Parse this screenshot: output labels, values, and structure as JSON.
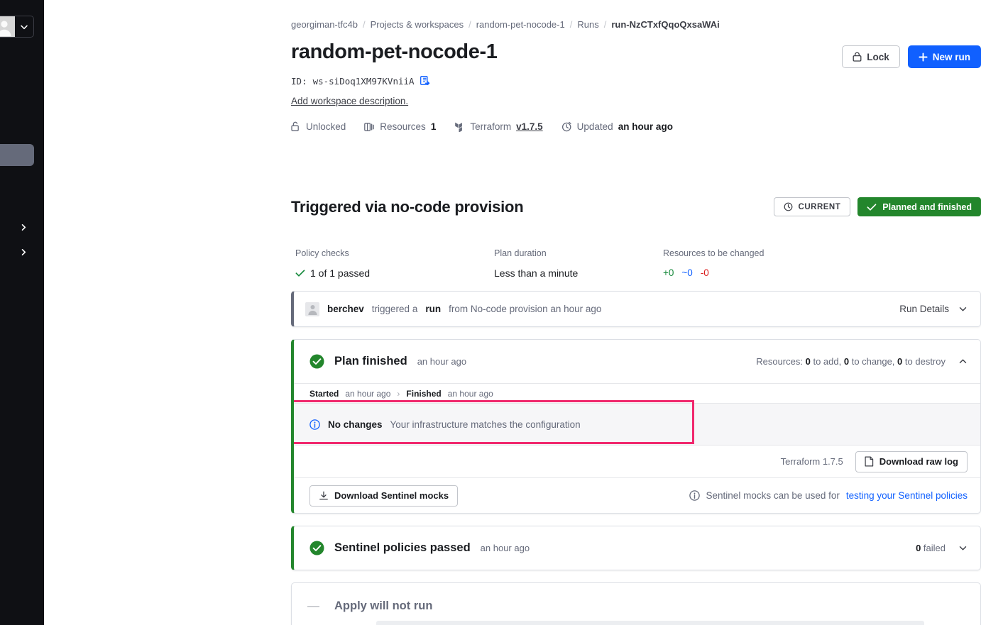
{
  "sidebar": {
    "avatar_icon": "user-avatar-icon",
    "profile_caret_icon": "chevron-down-icon",
    "collapse_label": "«",
    "chevron_icon": "chevron-right-icon"
  },
  "breadcrumb": {
    "items": [
      {
        "label": "georgiman-tfc4b",
        "current": false
      },
      {
        "label": "Projects & workspaces",
        "current": false
      },
      {
        "label": "random-pet-nocode-1",
        "current": false
      },
      {
        "label": "Runs",
        "current": false
      },
      {
        "label": "run-NzCTxfQqoQxsaWAi",
        "current": true
      }
    ],
    "separator": "/"
  },
  "workspace": {
    "title": "random-pet-nocode-1",
    "id_label": "ID:",
    "id_value": "ws-siDoq1XM97KVniiA",
    "copy_icon": "copy-icon",
    "description_link": "Add workspace description.",
    "meta": [
      {
        "icon": "unlock-icon",
        "label": "Unlocked",
        "value": "",
        "link": ""
      },
      {
        "icon": "resources-icon",
        "label": "Resources",
        "value": "1",
        "link": ""
      },
      {
        "icon": "terraform-icon",
        "label": "Terraform",
        "value": "",
        "link": "v1.7.5"
      },
      {
        "icon": "clock-icon",
        "label": "Updated",
        "value": "an hour ago",
        "link": ""
      }
    ]
  },
  "header_actions": {
    "lock_label": "Lock",
    "lock_icon": "lock-icon",
    "new_run_label": "New run",
    "new_run_icon": "plus-icon",
    "primary_color": "#1060ff"
  },
  "run": {
    "title": "Triggered via no-code provision",
    "current_badge": "CURRENT",
    "current_badge_icon": "clock-icon",
    "status_badge": "Planned and finished",
    "status_badge_icon": "check-icon",
    "status_color": "#23862c"
  },
  "stats": [
    {
      "label": "Policy checks",
      "value": "1 of 1 passed",
      "icon": "check-icon"
    },
    {
      "label": "Plan duration",
      "value": "Less than a minute",
      "icon": ""
    },
    {
      "label": "Resources to be changed",
      "add": "+0",
      "change": "~0",
      "destroy": "-0"
    }
  ],
  "trigger_card": {
    "avatar_icon": "user-avatar-icon",
    "user": "berchev",
    "text_1": "triggered a",
    "action": "run",
    "text_2": "from No-code provision an hour ago",
    "details_label": "Run Details",
    "caret_icon": "chevron-down-icon"
  },
  "plan_card": {
    "status_icon": "check-circle-icon",
    "title": "Plan finished",
    "time": "an hour ago",
    "resources_prefix": "Resources:",
    "add_count": "0",
    "add_text": "to add,",
    "change_count": "0",
    "change_text": "to change,",
    "destroy_count": "0",
    "destroy_text": "to destroy",
    "collapse_icon": "chevron-up-icon",
    "started_label": "Started",
    "started_time": "an hour ago",
    "arrow": "›",
    "finished_label": "Finished",
    "finished_time": "an hour ago",
    "no_changes_icon": "info-icon",
    "no_changes_title": "No changes",
    "no_changes_text": "Your infrastructure matches the configuration",
    "terraform_version": "Terraform 1.7.5",
    "download_log_label": "Download raw log",
    "download_log_icon": "file-icon",
    "sentinel_mocks_label": "Download Sentinel mocks",
    "sentinel_mocks_icon": "download-icon",
    "sentinel_note_icon": "info-icon",
    "sentinel_note_text": "Sentinel mocks can be used for",
    "sentinel_note_link": "testing your Sentinel policies",
    "highlight_color": "#f0286d"
  },
  "sentinel_card": {
    "status_icon": "check-circle-icon",
    "title": "Sentinel policies passed",
    "time": "an hour ago",
    "failed_count": "0",
    "failed_text": "failed",
    "caret_icon": "chevron-down-icon"
  },
  "apply_card": {
    "dash_icon": "dash-icon",
    "title": "Apply will not run"
  }
}
